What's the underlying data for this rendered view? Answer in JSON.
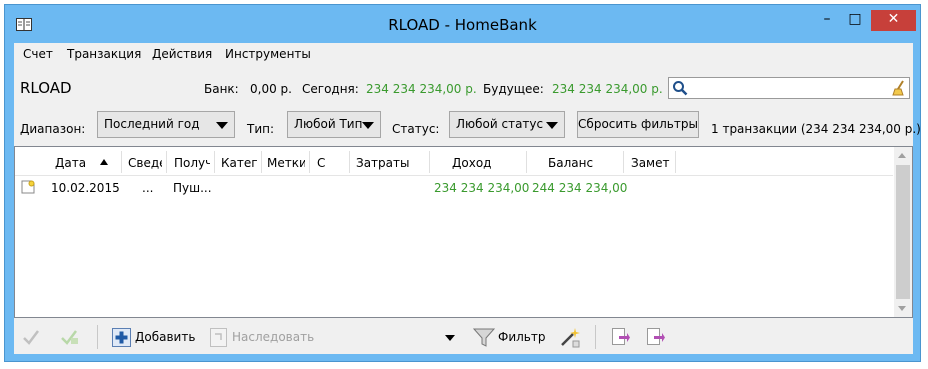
{
  "window": {
    "title": "RLOAD - HomeBank",
    "minimize_glyph": "–",
    "maximize_glyph": "□",
    "close_glyph": "✕"
  },
  "menu": [
    {
      "label": "Счет"
    },
    {
      "label": "Транзакция"
    },
    {
      "label": "Действия"
    },
    {
      "label": "Инструменты"
    }
  ],
  "account": {
    "name": "RLOAD",
    "bank_label": "Банк:",
    "bank_value": "0,00 р.",
    "today_label": "Сегодня:",
    "today_value": "234 234 234,00 р.",
    "future_label": "Будущее:",
    "future_value": "234 234 234,00 р."
  },
  "search": {
    "value": "",
    "placeholder": ""
  },
  "filters": {
    "range_label": "Диапазон:",
    "range_value": "Последний год",
    "type_label": "Тип:",
    "type_value": "Любой Тип",
    "status_label": "Статус:",
    "status_value": "Любой статус",
    "reset_label": "Сбросить фильтры",
    "summary": "1 транзакции (234 234 234,00 р.)"
  },
  "columns": [
    "Дата",
    "Сведе",
    "Получ",
    "Катег",
    "Метки",
    "С",
    "Затраты",
    "Доход",
    "Баланс",
    "Замет"
  ],
  "rows": [
    {
      "date": "10.02.2015",
      "info": "...",
      "payee": "Пуш...",
      "category": "",
      "tags": "",
      "status": "",
      "expense": "",
      "income": "234 234 234,00",
      "balance": "244 234 234,00",
      "memo": ""
    }
  ],
  "toolbar": {
    "add_label": "Добавить",
    "inherit_label": "Наследовать",
    "filter_label": "Фильтр"
  },
  "colors": {
    "positive": "#3a9a2e",
    "titlebar": "#6cb9f2",
    "close": "#c7403a"
  },
  "icons": [
    "book-icon",
    "search-icon",
    "clear-icon",
    "sort-asc-icon",
    "transaction-note-icon",
    "checkmark-icon",
    "validate-icon",
    "add-icon",
    "inherit-icon",
    "dropdown-icon",
    "filter-icon",
    "magic-wand-icon",
    "export-icon",
    "report-icon"
  ]
}
